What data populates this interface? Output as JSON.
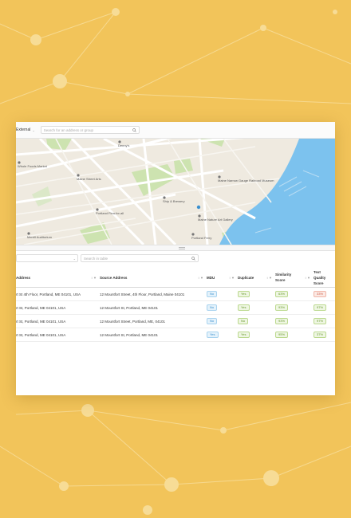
{
  "topbar": {
    "dropdown_value": "External",
    "search_placeholder": "Search for an address or group"
  },
  "map": {
    "labels": [
      {
        "name": "poi-dennys",
        "text": "Denny's"
      },
      {
        "name": "poi-whole-foods",
        "text": "Whole Foods Market"
      },
      {
        "name": "poi-maine-street-arts",
        "text": "Maine Street Arts"
      },
      {
        "name": "poi-portland-flea",
        "text": "Portland Flea-for-all"
      },
      {
        "name": "poi-maine-narrow-gauge",
        "text": "Maine Narrow Gauge Railroad Museum"
      },
      {
        "name": "poi-ship-rock",
        "text": "Ship & Brewery"
      },
      {
        "name": "poi-maine-nature",
        "text": "Maine Nature Art Gallery"
      },
      {
        "name": "poi-merrill",
        "text": "Merrill Auditorium"
      },
      {
        "name": "poi-portland-ferry",
        "text": "Portland Ferry"
      }
    ]
  },
  "filter": {
    "search_placeholder": "Search in table"
  },
  "table": {
    "columns": [
      {
        "label": "Address"
      },
      {
        "label": "Source Address"
      },
      {
        "label": "MDU"
      },
      {
        "label": "Duplicate"
      },
      {
        "label": "Similarity Score"
      },
      {
        "label": "Text Quality Score"
      }
    ],
    "rows": [
      {
        "address": "rt St 4th Floor, Portland, ME 04101, USA",
        "source": "12 Mountfort Street, 4th Floor, Portland, Maine 04101",
        "mdu": "No",
        "duplicate": "Yes",
        "similarity": "63%",
        "quality": "33%",
        "quality_status": "low"
      },
      {
        "address": "rt St, Portland, ME 04101, USA",
        "source": "12 Mountfort St, Portland, ME 04101",
        "mdu": "No",
        "duplicate": "Yes",
        "similarity": "93%",
        "quality": "97%",
        "quality_status": "ok"
      },
      {
        "address": "rt St, Portland, ME 04101, USA",
        "source": "12 Mountfort Street, Portland, ME, 04101",
        "mdu": "No",
        "duplicate": "No",
        "similarity": "93%",
        "quality": "97%",
        "quality_status": "ok"
      },
      {
        "address": "rt St, Portland, ME 04101, USA",
        "source": "12 Mountfort St, Portland, ME 04101",
        "mdu": "Yes",
        "duplicate": "Yes",
        "similarity": "95%",
        "quality": "37%",
        "quality_status": "ok"
      }
    ]
  },
  "colors": {
    "background": "#f2c45a",
    "water": "#7cc2ee",
    "park": "#cde3b0",
    "badge_blue": "#3a8fcf",
    "badge_green": "#6a9a2e",
    "badge_red": "#d0604a"
  }
}
